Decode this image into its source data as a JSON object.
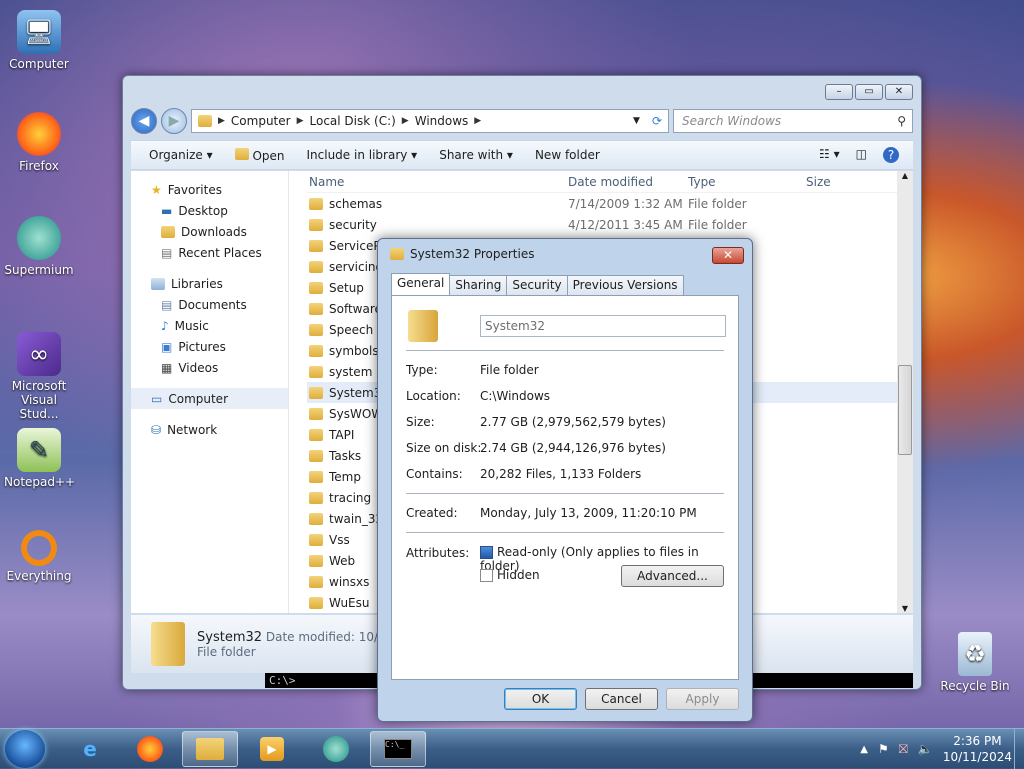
{
  "desktop_icons": [
    {
      "label": "Computer",
      "icon": "computer-icon"
    },
    {
      "label": "Firefox",
      "icon": "firefox-icon"
    },
    {
      "label": "Supermium",
      "icon": "supermium-icon"
    },
    {
      "label": "Microsoft Visual Stud...",
      "icon": "visual-studio-icon"
    },
    {
      "label": "Notepad++",
      "icon": "notepadpp-icon"
    },
    {
      "label": "Everything",
      "icon": "everything-icon"
    },
    {
      "label": "Recycle Bin",
      "icon": "recycle-bin-icon"
    }
  ],
  "explorer": {
    "address": {
      "seg1": "Computer",
      "seg2": "Local Disk (C:)",
      "seg3": "Windows"
    },
    "search_placeholder": "Search Windows",
    "toolbar": {
      "organize": "Organize",
      "open": "Open",
      "include": "Include in library",
      "share": "Share with",
      "newfolder": "New folder"
    },
    "nav": {
      "favorites": "Favorites",
      "desktop": "Desktop",
      "downloads": "Downloads",
      "recent": "Recent Places",
      "libraries": "Libraries",
      "documents": "Documents",
      "music": "Music",
      "pictures": "Pictures",
      "videos": "Videos",
      "computer": "Computer",
      "network": "Network"
    },
    "columns": {
      "name": "Name",
      "date": "Date modified",
      "type": "Type",
      "size": "Size"
    },
    "files": [
      {
        "name": "schemas",
        "date": "7/14/2009 1:32 AM",
        "type": "File folder"
      },
      {
        "name": "security",
        "date": "4/12/2011 3:45 AM",
        "type": "File folder"
      },
      {
        "name": "ServicePr",
        "date": "",
        "type": ""
      },
      {
        "name": "servicing",
        "date": "",
        "type": ""
      },
      {
        "name": "Setup",
        "date": "",
        "type": ""
      },
      {
        "name": "SoftwareD",
        "date": "",
        "type": ""
      },
      {
        "name": "Speech",
        "date": "",
        "type": ""
      },
      {
        "name": "symbols",
        "date": "",
        "type": ""
      },
      {
        "name": "system",
        "date": "",
        "type": ""
      },
      {
        "name": "System32",
        "date": "",
        "type": ""
      },
      {
        "name": "SysWOW",
        "date": "",
        "type": ""
      },
      {
        "name": "TAPI",
        "date": "",
        "type": ""
      },
      {
        "name": "Tasks",
        "date": "",
        "type": ""
      },
      {
        "name": "Temp",
        "date": "",
        "type": ""
      },
      {
        "name": "tracing",
        "date": "",
        "type": ""
      },
      {
        "name": "twain_32",
        "date": "",
        "type": ""
      },
      {
        "name": "Vss",
        "date": "",
        "type": ""
      },
      {
        "name": "Web",
        "date": "",
        "type": ""
      },
      {
        "name": "winsxs",
        "date": "",
        "type": ""
      },
      {
        "name": "WuEsu",
        "date": "",
        "type": ""
      }
    ],
    "status": {
      "name": "System32",
      "meta": "Date modified: 10/11",
      "type": "File folder"
    }
  },
  "cmd_text": "C:\\>",
  "dialog": {
    "title": "System32 Properties",
    "tabs": [
      "General",
      "Sharing",
      "Security",
      "Previous Versions"
    ],
    "name_value": "System32",
    "rows": {
      "type_label": "Type:",
      "type_value": "File folder",
      "location_label": "Location:",
      "location_value": "C:\\Windows",
      "size_label": "Size:",
      "size_value": "2.77 GB (2,979,562,579 bytes)",
      "sizeondisk_label": "Size on disk:",
      "sizeondisk_value": "2.74 GB (2,944,126,976 bytes)",
      "contains_label": "Contains:",
      "contains_value": "20,282 Files, 1,133 Folders",
      "created_label": "Created:",
      "created_value": "Monday, July 13, 2009, 11:20:10 PM",
      "attributes_label": "Attributes:"
    },
    "readonly_label": "Read-only (Only applies to files in folder)",
    "hidden_label": "Hidden",
    "advanced_label": "Advanced...",
    "ok_label": "OK",
    "cancel_label": "Cancel",
    "apply_label": "Apply"
  },
  "taskbar": {
    "time": "2:36 PM",
    "date": "10/11/2024"
  }
}
